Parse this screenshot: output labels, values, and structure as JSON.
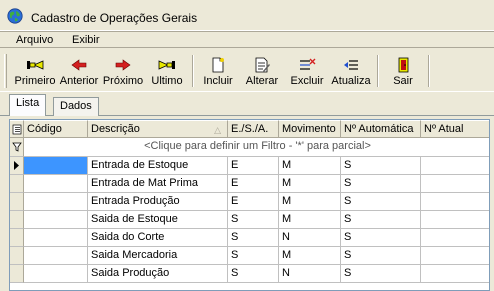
{
  "window": {
    "title": "Cadastro de Operações Gerais",
    "app_icon": "globe-icon"
  },
  "menu": {
    "items": [
      "Arquivo",
      "Exibir"
    ]
  },
  "toolbar": {
    "buttons": [
      {
        "label": "Primeiro",
        "icon": "first-record-icon"
      },
      {
        "label": "Anterior",
        "icon": "previous-record-icon"
      },
      {
        "label": "Próximo",
        "icon": "next-record-icon"
      },
      {
        "label": "Ultimo",
        "icon": "last-record-icon"
      },
      {
        "label": "Incluir",
        "icon": "new-document-icon"
      },
      {
        "label": "Alterar",
        "icon": "edit-document-icon"
      },
      {
        "label": "Excluir",
        "icon": "delete-record-icon"
      },
      {
        "label": "Atualiza",
        "icon": "refresh-icon"
      },
      {
        "label": "Sair",
        "icon": "exit-door-icon"
      }
    ]
  },
  "tabs": [
    {
      "label": "Lista"
    },
    {
      "label": "Dados"
    }
  ],
  "grid": {
    "columns": [
      "Código",
      "Descrição",
      "E./S./A.",
      "Movimento",
      "Nº Automática",
      "Nº Atual"
    ],
    "filter_hint": "<Clique para definir um Filtro - '*' para parcial>",
    "rows": [
      [
        "",
        "Entrada de Estoque",
        "E",
        "M",
        "S",
        ""
      ],
      [
        "",
        "Entrada de Mat Prima",
        "E",
        "M",
        "S",
        ""
      ],
      [
        "",
        "Entrada Produção",
        "E",
        "M",
        "S",
        ""
      ],
      [
        "",
        "Saida de Estoque",
        "S",
        "M",
        "S",
        ""
      ],
      [
        "",
        "Saida do Corte",
        "S",
        "N",
        "S",
        ""
      ],
      [
        "",
        "Saida Mercadoria",
        "S",
        "M",
        "S",
        ""
      ],
      [
        "",
        "Saida Produção",
        "S",
        "N",
        "S",
        ""
      ]
    ]
  }
}
